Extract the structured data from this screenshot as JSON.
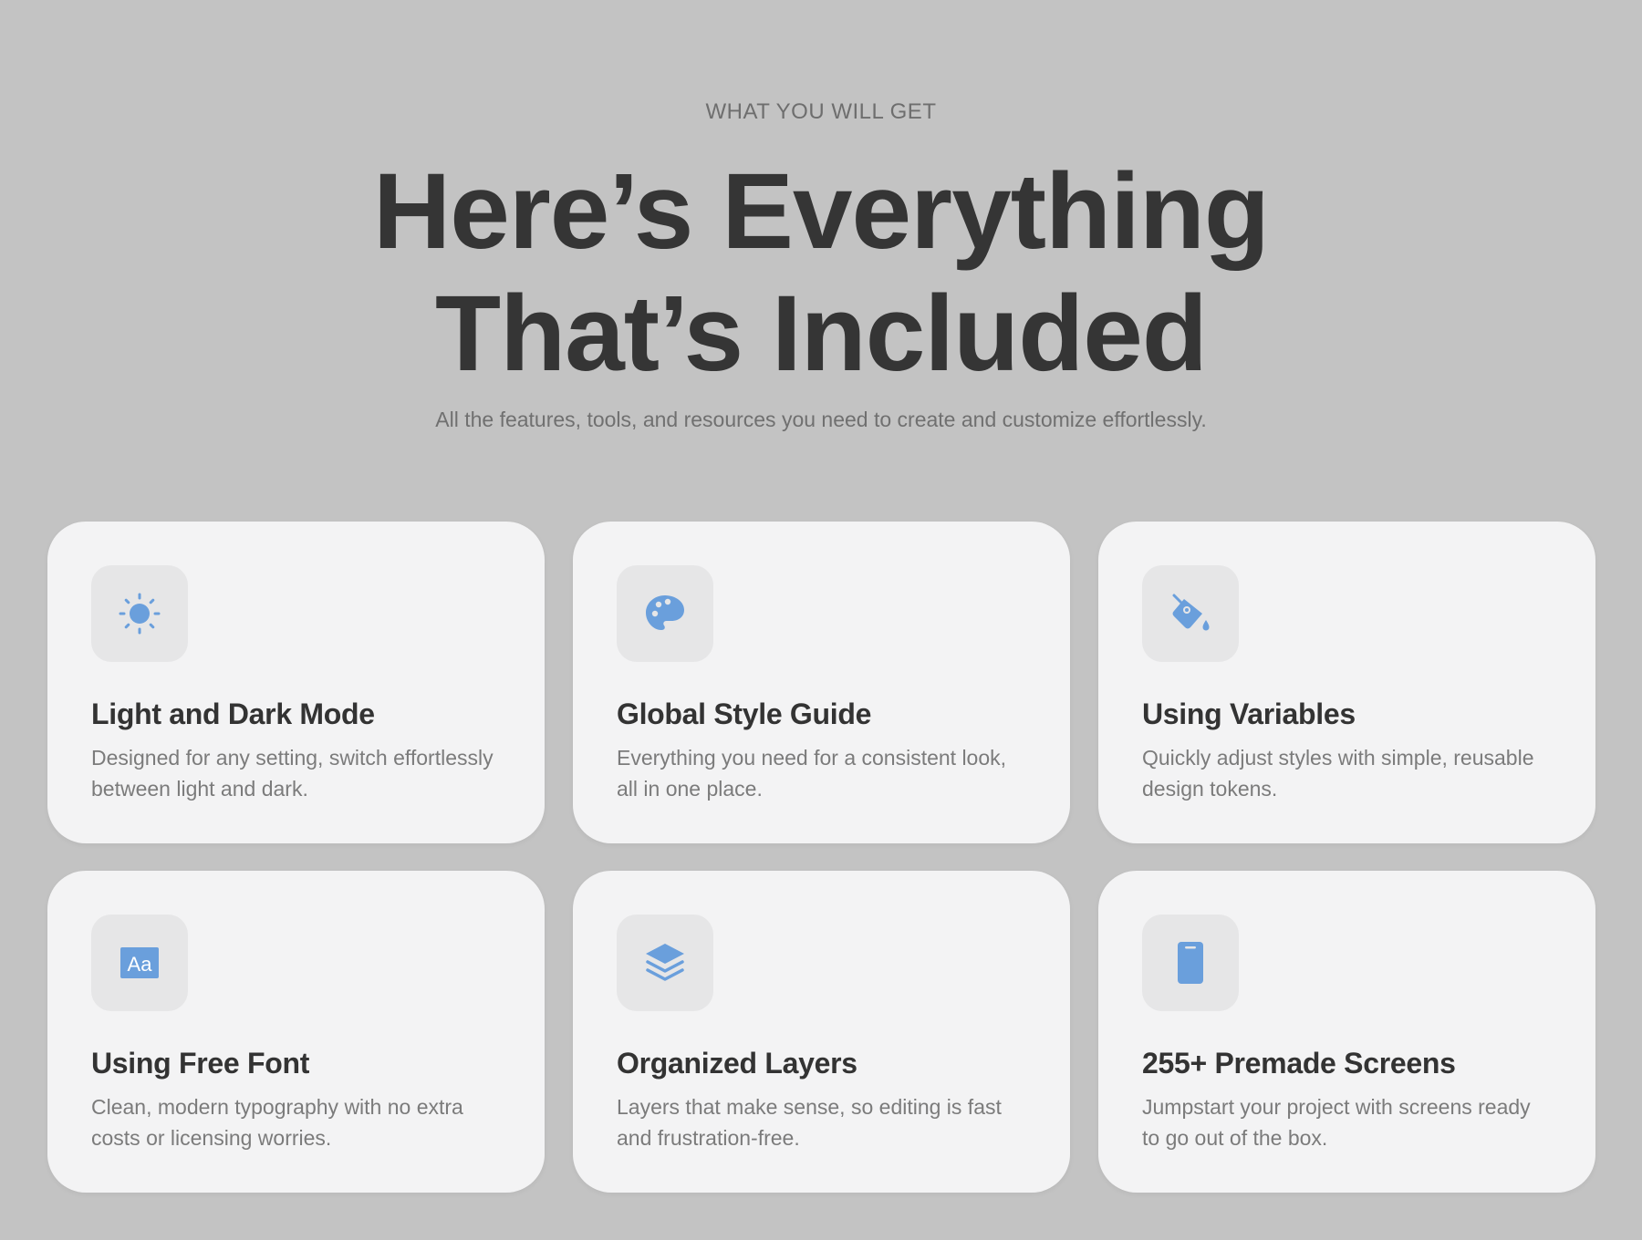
{
  "section": {
    "eyebrow": "WHAT YOU WILL GET",
    "headline_line1": "Here’s Everything",
    "headline_line2": "That’s Included",
    "subtitle": "All the features, tools, and resources you need to create and customize effortlessly."
  },
  "colors": {
    "background": "#c3c3c3",
    "card": "#f3f3f4",
    "icon_bg": "#e6e6e7",
    "accent": "#6a9fdc",
    "heading": "#353535",
    "muted_text": "#7b7b7b"
  },
  "features": [
    {
      "icon": "sun-icon",
      "title": "Light and Dark Mode",
      "description": "Designed for any setting, switch effortlessly between light and dark."
    },
    {
      "icon": "palette-icon",
      "title": "Global Style Guide",
      "description": "Everything you need for a consistent look, all in one place."
    },
    {
      "icon": "paint-bucket-icon",
      "title": "Using Variables",
      "description": "Quickly adjust styles with simple, reusable design tokens."
    },
    {
      "icon": "font-icon",
      "title": "Using Free Font",
      "description": "Clean, modern typography with no extra costs or licensing worries."
    },
    {
      "icon": "layers-icon",
      "title": "Organized Layers",
      "description": "Layers that make sense, so editing is fast and frustration-free."
    },
    {
      "icon": "phone-icon",
      "title": "255+ Premade Screens",
      "description": "Jumpstart your project with screens ready to go out of the box."
    }
  ]
}
